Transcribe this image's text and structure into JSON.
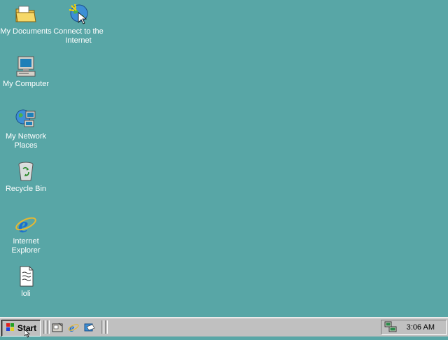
{
  "desktop": {
    "background_color": "#58a6a6",
    "icons": [
      {
        "label": "My Documents",
        "icon": "folder-documents-icon"
      },
      {
        "label": "Connect to the Internet",
        "icon": "connect-internet-icon"
      },
      {
        "label": "My Computer",
        "icon": "computer-icon"
      },
      {
        "label": "My Network Places",
        "icon": "network-places-icon"
      },
      {
        "label": "Recycle Bin",
        "icon": "recycle-bin-icon"
      },
      {
        "label": "Internet Explorer",
        "icon": "internet-explorer-icon"
      },
      {
        "label": "loli",
        "icon": "text-document-icon"
      }
    ]
  },
  "taskbar": {
    "start_label": "Start",
    "quick_launch": [
      "show-desktop-icon",
      "internet-explorer-icon",
      "outlook-express-icon"
    ],
    "clock": "3:06 AM",
    "tray_icons": [
      "network-tray-icon"
    ]
  }
}
